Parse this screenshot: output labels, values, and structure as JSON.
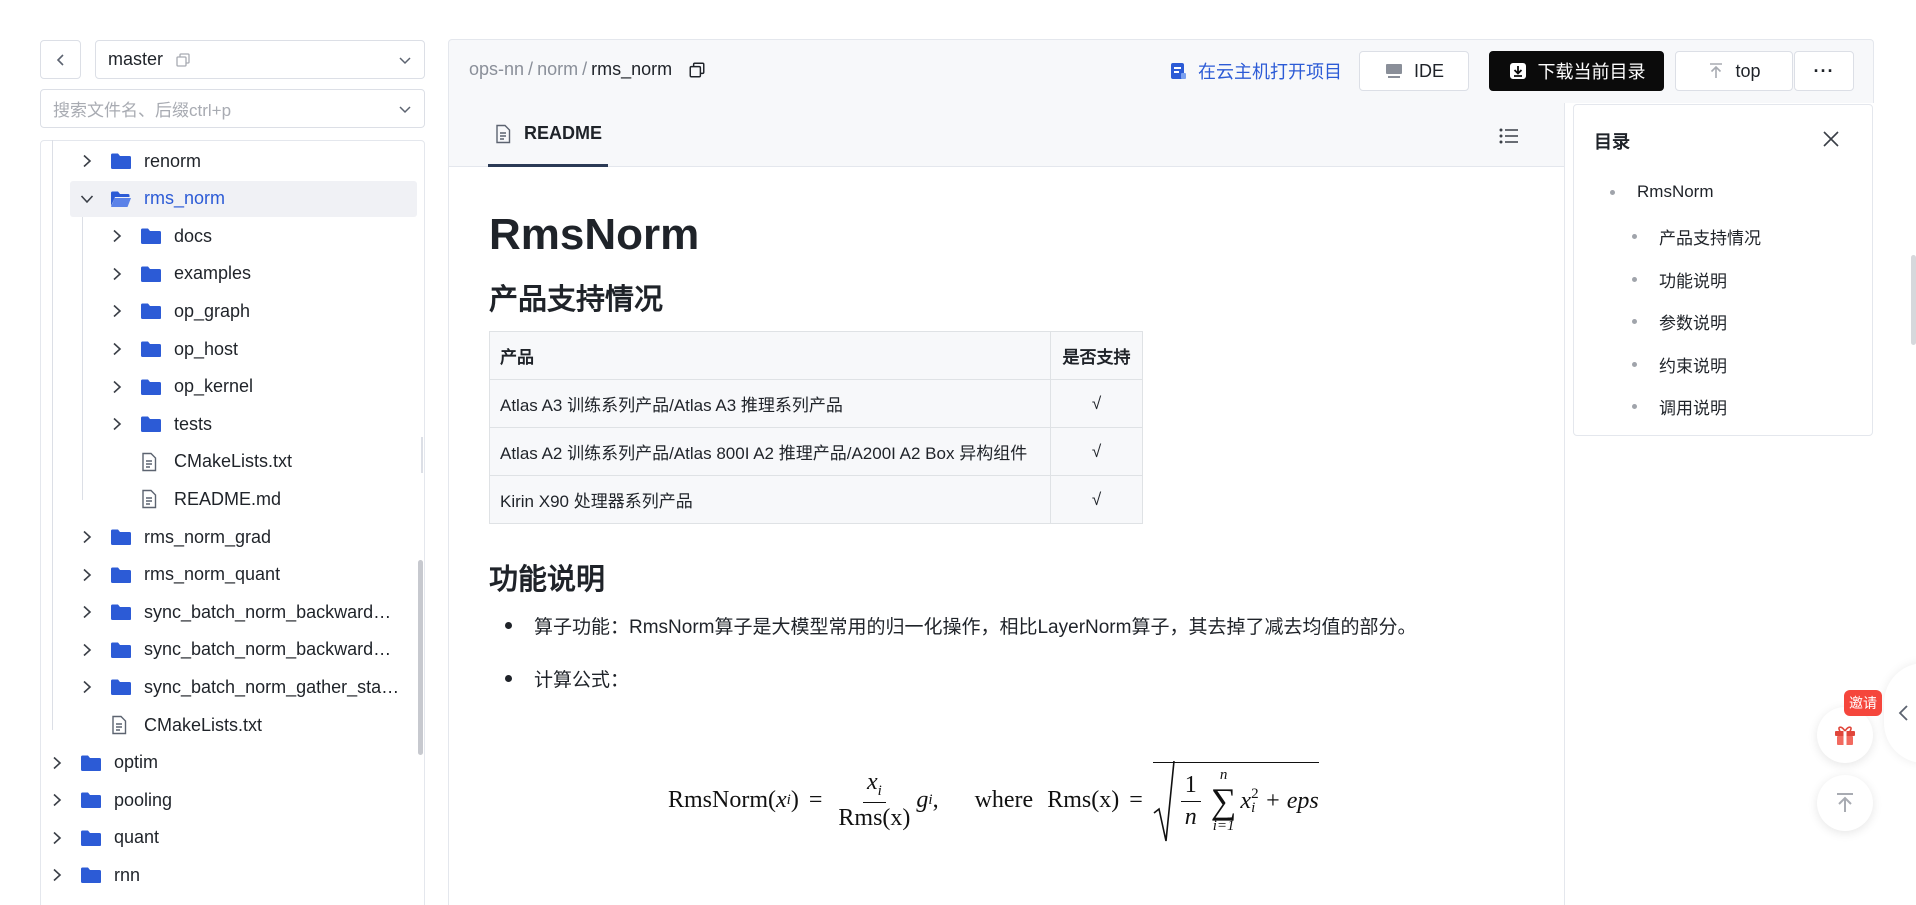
{
  "branch": {
    "name": "master"
  },
  "search": {
    "placeholder": "搜索文件名、后缀ctrl+p"
  },
  "tree": {
    "items": [
      {
        "label": "renorm",
        "type": "folder"
      },
      {
        "label": "rms_norm",
        "type": "folder-open"
      },
      {
        "label": "docs",
        "type": "folder"
      },
      {
        "label": "examples",
        "type": "folder"
      },
      {
        "label": "op_graph",
        "type": "folder"
      },
      {
        "label": "op_host",
        "type": "folder"
      },
      {
        "label": "op_kernel",
        "type": "folder"
      },
      {
        "label": "tests",
        "type": "folder"
      },
      {
        "label": "CMakeLists.txt",
        "type": "file"
      },
      {
        "label": "README.md",
        "type": "file"
      },
      {
        "label": "rms_norm_grad",
        "type": "folder"
      },
      {
        "label": "rms_norm_quant",
        "type": "folder"
      },
      {
        "label": "sync_batch_norm_backward…",
        "type": "folder"
      },
      {
        "label": "sync_batch_norm_backward…",
        "type": "folder"
      },
      {
        "label": "sync_batch_norm_gather_sta…",
        "type": "folder"
      },
      {
        "label": "CMakeLists.txt",
        "type": "file"
      },
      {
        "label": "optim",
        "type": "folder"
      },
      {
        "label": "pooling",
        "type": "folder"
      },
      {
        "label": "quant",
        "type": "folder"
      },
      {
        "label": "rnn",
        "type": "folder"
      }
    ]
  },
  "breadcrumb": {
    "root": "ops-nn",
    "sep": "/",
    "mid": "norm",
    "current": "rms_norm"
  },
  "toolbar": {
    "cloud_label": "在云主机打开项目",
    "ide_label": "IDE",
    "download_label": "下载当前目录",
    "top_label": "top",
    "more_label": "···"
  },
  "readme": {
    "tab_label": "README",
    "title": "RmsNorm",
    "section_support": "产品支持情况",
    "table": {
      "headers": [
        "产品",
        "是否支持"
      ],
      "rows": [
        [
          "Atlas A3 训练系列产品/Atlas A3 推理系列产品",
          "√"
        ],
        [
          "Atlas A2 训练系列产品/Atlas 800I A2 推理产品/A200I A2 Box 异构组件",
          "√"
        ],
        [
          "Kirin X90 处理器系列产品",
          "√"
        ]
      ]
    },
    "section_function": "功能说明",
    "bullets": [
      "算子功能：RmsNorm算子是大模型常用的归一化操作，相比LayerNorm算子，其去掉了减去均值的部分。",
      "计算公式："
    ],
    "formula": {
      "lhs": "RmsNorm",
      "arg": "x",
      "sub_i": "i",
      "eq": "=",
      "num": "x",
      "den": "Rms(x)",
      "g": "g",
      "comma": ",",
      "where": "where",
      "rms": "Rms(x)",
      "sqrt_num": "1",
      "sqrt_den": "n",
      "sum_top": "n",
      "sum_bottom": "i=1",
      "sq": "2",
      "eps": "+ eps"
    }
  },
  "toc": {
    "title": "目录",
    "items": [
      "RmsNorm",
      "产品支持情况",
      "功能说明",
      "参数说明",
      "约束说明",
      "调用说明"
    ]
  },
  "float": {
    "invite_label": "邀请"
  },
  "colors": {
    "accent": "#2c5bd6",
    "folder": "#2c5bd6",
    "dark_button": "#0b0b0b",
    "badge": "#f5463c"
  }
}
